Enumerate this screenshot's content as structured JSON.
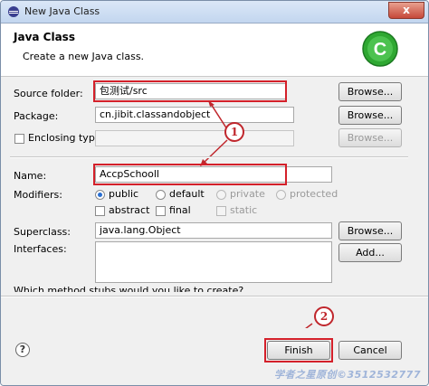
{
  "window": {
    "title": "New Java Class",
    "close_label": "x"
  },
  "header": {
    "title": "Java Class",
    "description": "Create a new Java class."
  },
  "form": {
    "source_folder": {
      "label": "Source folder:",
      "value": "包测试/src",
      "browse": "Browse..."
    },
    "package": {
      "label": "Package:",
      "value": "cn.jibit.classandobject",
      "browse": "Browse..."
    },
    "enclosing_type": {
      "label": "Enclosing type:",
      "value": "",
      "browse": "Browse...",
      "checked": false
    },
    "name": {
      "label": "Name:",
      "value": "AccpSchooll"
    },
    "modifiers": {
      "label": "Modifiers:",
      "access": [
        {
          "label": "public",
          "selected": true,
          "enabled": true
        },
        {
          "label": "default",
          "selected": false,
          "enabled": true
        },
        {
          "label": "private",
          "selected": false,
          "enabled": false
        },
        {
          "label": "protected",
          "selected": false,
          "enabled": false
        }
      ],
      "flags": [
        {
          "label": "abstract",
          "checked": false,
          "enabled": true
        },
        {
          "label": "final",
          "checked": false,
          "enabled": true
        },
        {
          "label": "static",
          "checked": false,
          "enabled": false
        }
      ]
    },
    "superclass": {
      "label": "Superclass:",
      "value": "java.lang.Object",
      "browse": "Browse..."
    },
    "interfaces": {
      "label": "Interfaces:",
      "add": "Add..."
    },
    "method_stubs_prompt": "Which method stubs would you like to create?"
  },
  "callouts": [
    "1",
    "2"
  ],
  "footer": {
    "help": "?",
    "finish": "Finish",
    "cancel": "Cancel"
  },
  "watermark": "学者之星原创©3512532777",
  "colors": {
    "highlight_box": "#d4202a",
    "logo_green": "#2fa832"
  }
}
